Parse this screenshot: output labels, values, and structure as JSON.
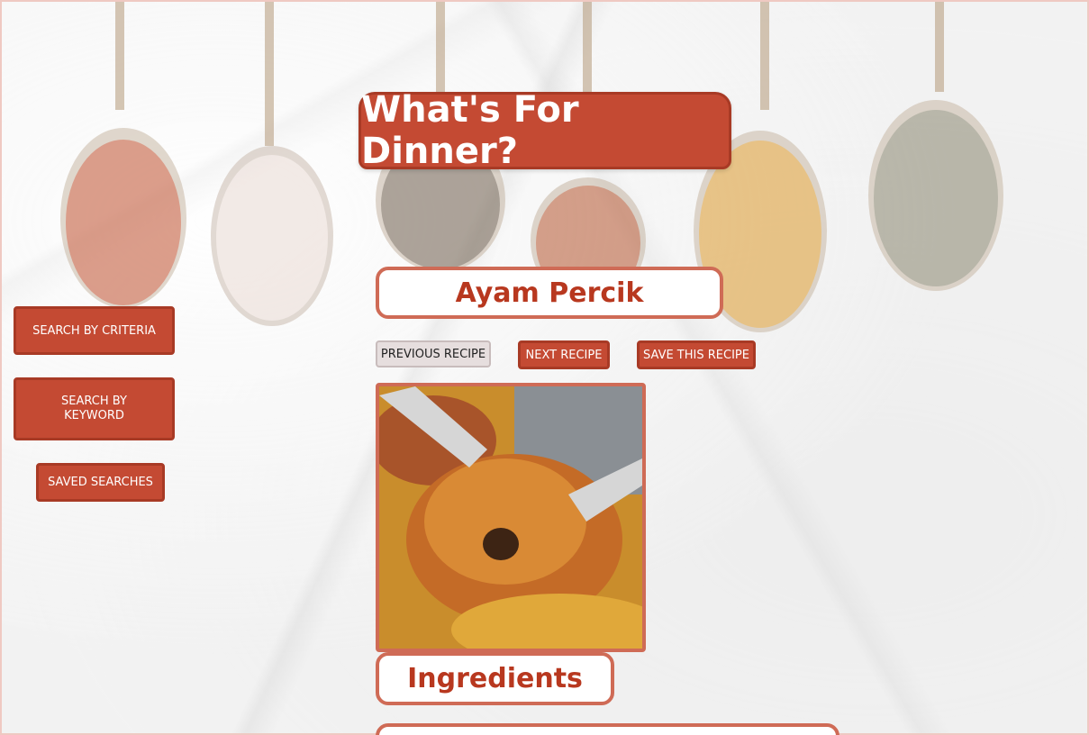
{
  "header": {
    "title": "What's For Dinner?"
  },
  "sidebar": {
    "search_criteria": "SEARCH BY CRITERIA",
    "search_keyword": "SEARCH BY KEYWORD",
    "saved_searches": "SAVED SEARCHES"
  },
  "recipe": {
    "name": "Ayam Percik",
    "prev_label": "PREVIOUS RECIPE",
    "next_label": "NEXT RECIPE",
    "save_label": "SAVE THIS RECIPE",
    "ingredients_heading": "Ingredients"
  },
  "colors": {
    "accent": "#c44a33",
    "accent_text": "#b8381f",
    "border": "#cf6b56"
  }
}
